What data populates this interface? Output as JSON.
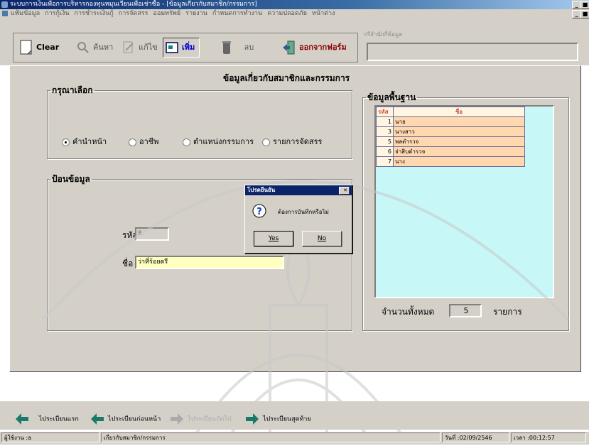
{
  "window": {
    "title": "ระบบการเงินเพื่อการบริหารกองทุนหมุนเวียนเพื่อเช่าซื้อ - [ข้อมูลเกี่ยวกับสมาชิก/กรรมการ]",
    "buttons": [
      "_",
      "■",
      "x"
    ]
  },
  "menu": [
    "แฟ้มข้อมูล",
    "การกู้เงิน",
    "การชำระเงินกู้",
    "การจัดสรร",
    "ออมทรัพย์",
    "รายงาน",
    "กำหนดการทำงาน",
    "ความปลอดภัย",
    "หน้าต่าง"
  ],
  "toolbar": {
    "clear": "Clear",
    "search": "ค้นหา",
    "edit": "แก้ไข",
    "add": "เพิ่ม",
    "delete": "ลบ",
    "exit": "ออกจากฟอร์ม",
    "info_label": "กรีจำนักกี่ข้อมูล",
    "info_value": ""
  },
  "heading": "ข้อมูลเกี่ยวกับสมาชิกและกรรมการ",
  "choose": {
    "legend": "กรุณาเลือก",
    "options": [
      "คำนำหน้า",
      "อาชีพ",
      "ตำแหน่งกรรมการ",
      "รายการจัดสรร"
    ],
    "selected_index": 0
  },
  "entry": {
    "legend": "ป้อนข้อมูล",
    "code_label": "รหัส",
    "code_value": "8",
    "name_label": "ชื่อ",
    "name_value": "ว่าที่ร้อยตรี"
  },
  "base": {
    "legend": "ข้อมูลพื้นฐาน",
    "columns": [
      "รหัส",
      "ชื่อ"
    ],
    "rows": [
      {
        "code": "1",
        "name": "นาย"
      },
      {
        "code": "3",
        "name": "นางสาว"
      },
      {
        "code": "5",
        "name": "พลตำรวจ"
      },
      {
        "code": "6",
        "name": "จ่าสิบตำรวจ"
      },
      {
        "code": "7",
        "name": "นาง"
      }
    ],
    "total_label": "จำนวนทั้งหมด",
    "total_value": "5",
    "total_unit": "รายการ"
  },
  "dialog": {
    "title": "โปรดยืนยัน",
    "message": "ต้องการบันทึกหรือไม่",
    "yes": "Yes",
    "no": "No"
  },
  "nav": {
    "first": "ไประเบียนแรก",
    "prev": "ไประเบียนก่อนหน้า",
    "next": "ไประเบียนถัดไป",
    "last": "ไประเบียนสุดท้าย"
  },
  "status": {
    "user": "ผู้ใช้งาน :a",
    "form": "เกี่ยวกับสมาชิก/กรรมการ",
    "date": "วันที่ :02/09/2546",
    "time": "เวลา :00:12:57"
  },
  "colors": {
    "nav_arrow": "#1a7a6a",
    "grid_bg": "#c8f7f7",
    "title_bar": "#0a246a"
  }
}
